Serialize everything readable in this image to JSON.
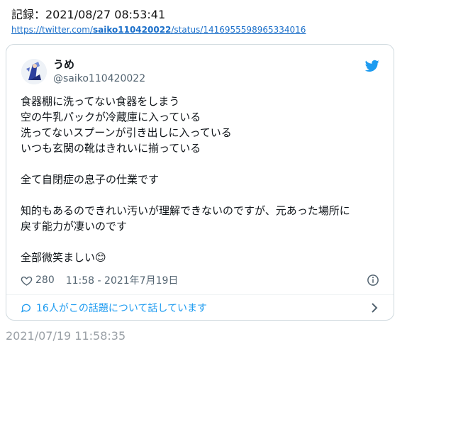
{
  "record": {
    "label": "記録：2021/08/27 08:53:41"
  },
  "source_link": {
    "prefix": "https://twitter.com/",
    "user": "saiko110420022",
    "suffix": "/status/1416955598965334016"
  },
  "tweet": {
    "author_name": "うめ",
    "author_handle": "@saiko110420022",
    "text": "食器棚に洗ってない食器をしまう\n空の牛乳パックが冷蔵庫に入っている\n洗ってないスプーンが引き出しに入っている\nいつも玄関の靴はきれいに揃っている\n\n全て自閉症の息子の仕業です\n\n知的もあるのできれい汚いが理解できないのですが、元あった場所に\n戻す能力が凄いのです\n\n全部微笑ましい😊",
    "likes": "280",
    "timestamp": "11:58 - 2021年7月19日",
    "conversation": "16人がこの話題について話しています"
  },
  "captured_at": "2021/07/19 11:58:35",
  "colors": {
    "twitter_blue": "#1d9bf0",
    "link_blue": "#1b6fc9",
    "muted": "#536471",
    "border": "#cfd9de"
  },
  "icons": {
    "brand": "twitter-bird-icon",
    "like": "heart-icon",
    "info": "info-icon",
    "reply": "speech-bubble-icon",
    "more": "chevron-right-icon"
  }
}
